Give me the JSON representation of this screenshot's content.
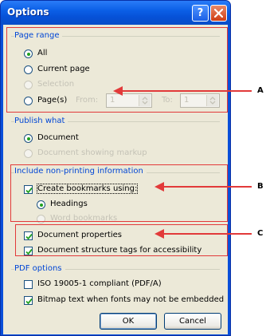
{
  "window": {
    "title": "Options"
  },
  "page_range": {
    "label": "Page range",
    "all": "All",
    "current_page": "Current page",
    "selection": "Selection",
    "pages": "Page(s)",
    "from_label": "From:",
    "from_value": "1",
    "to_label": "To:",
    "to_value": "1"
  },
  "publish_what": {
    "label": "Publish what",
    "document": "Document",
    "document_markup": "Document showing markup"
  },
  "non_printing": {
    "label": "Include non-printing information",
    "create_bookmarks": "Create bookmarks using:",
    "headings": "Headings",
    "word_bookmarks": "Word bookmarks",
    "document_properties": "Document properties",
    "structure_tags": "Document structure tags for accessibility"
  },
  "pdf_options": {
    "label": "PDF options",
    "iso": "ISO 19005-1 compliant (PDF/A)",
    "bitmap": "Bitmap text when fonts may not be embedded"
  },
  "buttons": {
    "ok": "OK",
    "cancel": "Cancel"
  },
  "annotations": {
    "a": "A",
    "b": "B",
    "c": "C"
  },
  "colors": {
    "annotation": "#e23a3a",
    "group_label": "#0046d5",
    "title_bar": "#0b5fe6"
  }
}
